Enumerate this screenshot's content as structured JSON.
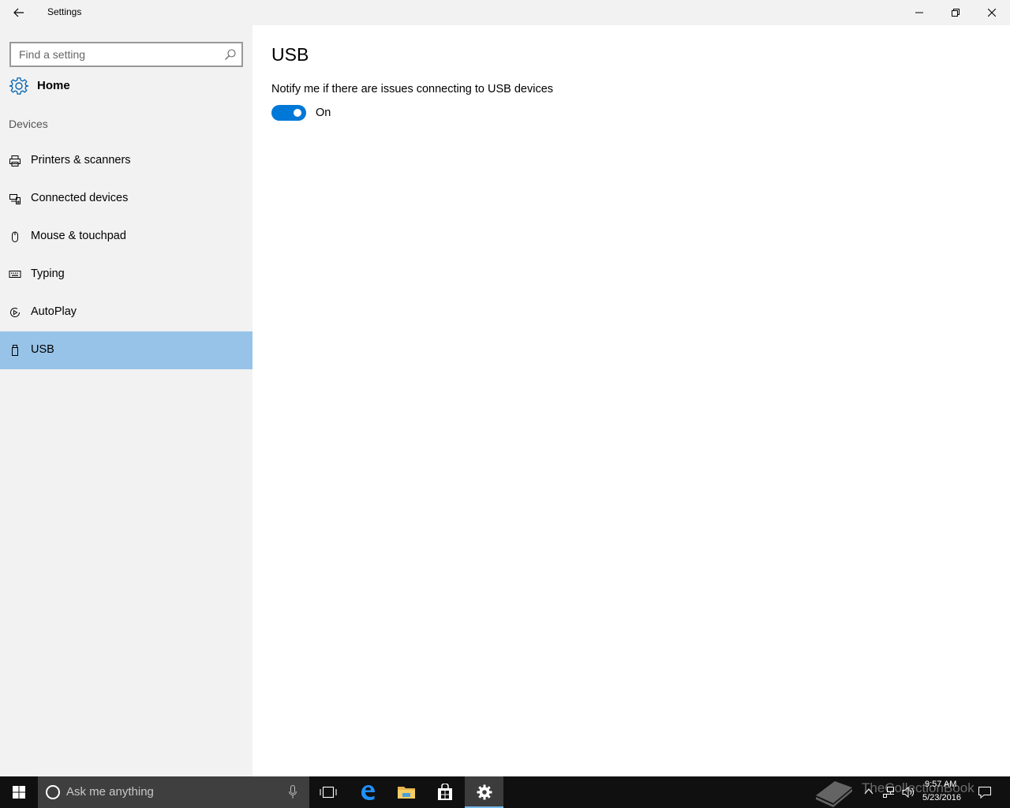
{
  "window": {
    "title": "Settings"
  },
  "sidebar": {
    "search_placeholder": "Find a setting",
    "home_label": "Home",
    "section_title": "Devices",
    "items": [
      {
        "label": "Printers & scanners",
        "icon": "printer-icon"
      },
      {
        "label": "Connected devices",
        "icon": "connected-devices-icon"
      },
      {
        "label": "Mouse & touchpad",
        "icon": "mouse-icon"
      },
      {
        "label": "Typing",
        "icon": "keyboard-icon"
      },
      {
        "label": "AutoPlay",
        "icon": "autoplay-icon"
      },
      {
        "label": "USB",
        "icon": "usb-icon",
        "selected": true
      }
    ]
  },
  "main": {
    "title": "USB",
    "setting_label": "Notify me if there are issues connecting to USB devices",
    "toggle_on": true,
    "toggle_state": "On"
  },
  "taskbar": {
    "search_placeholder": "Ask me anything",
    "watermark": "TheCollectionBook",
    "time": "9:57 AM",
    "date": "5/23/2016"
  },
  "colors": {
    "accent": "#0078d7",
    "selected_item": "#98c3e8",
    "taskbar": "#101010"
  }
}
